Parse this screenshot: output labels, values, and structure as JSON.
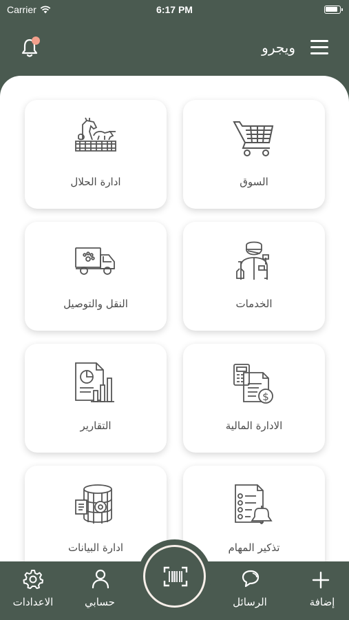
{
  "status_bar": {
    "carrier": "Carrier",
    "time": "6:17 PM"
  },
  "header": {
    "title": "ويجرو",
    "notification_badge_color": "#f3a08c",
    "accent_color": "#4a5a50"
  },
  "tiles": [
    {
      "label": "السوق",
      "icon": "shopping-cart-icon"
    },
    {
      "label": "ادارة الحلال",
      "icon": "livestock-icon"
    },
    {
      "label": "الخدمات",
      "icon": "service-worker-icon"
    },
    {
      "label": "النقل والتوصيل",
      "icon": "delivery-truck-icon"
    },
    {
      "label": "الادارة المالية",
      "icon": "finance-invoice-icon"
    },
    {
      "label": "التقارير",
      "icon": "reports-icon"
    },
    {
      "label": "تذكير المهام",
      "icon": "task-reminder-icon"
    },
    {
      "label": "ادارة البيانات",
      "icon": "database-icon"
    }
  ],
  "bottom_nav": {
    "add": "إضافة",
    "messages": "الرسائل",
    "scan_icon": "barcode-scan-icon",
    "account": "حسابي",
    "settings": "الاعدادات"
  }
}
